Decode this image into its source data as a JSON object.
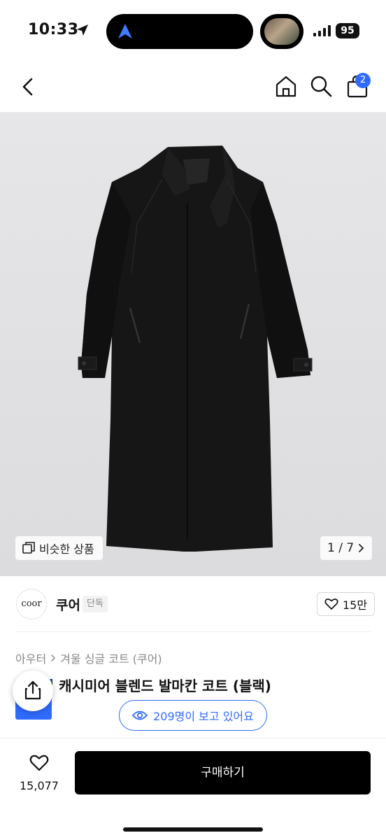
{
  "status_bar": {
    "time": "10:33",
    "battery": "95",
    "icons": [
      "location-arrow-icon",
      "navigation-arrow-icon",
      "signal-icon",
      "battery-icon"
    ]
  },
  "header": {
    "cart_badge": "2",
    "icons": [
      "back-icon",
      "home-icon",
      "search-icon",
      "cart-icon"
    ]
  },
  "gallery": {
    "similar_label": "비슷한 상품",
    "page_indicator": "1 / 7",
    "background_color": "#e2e2e4"
  },
  "brand": {
    "logo_text": "coor",
    "name": "쿠어",
    "tag": "단독",
    "likes": "15만"
  },
  "breadcrumb": {
    "category": "아우터",
    "subcategory": "겨울 싱글 코트 (쿠어)"
  },
  "product": {
    "title": "벨라디 캐시미어 블렌드 발마칸 코트 (블랙)"
  },
  "viewers": {
    "text": "209명이 보고 있어요",
    "color": "#2f6bff"
  },
  "bottom_bar": {
    "wish_count": "15,077",
    "buy_label": "구매하기",
    "buy_color": "#000000"
  }
}
